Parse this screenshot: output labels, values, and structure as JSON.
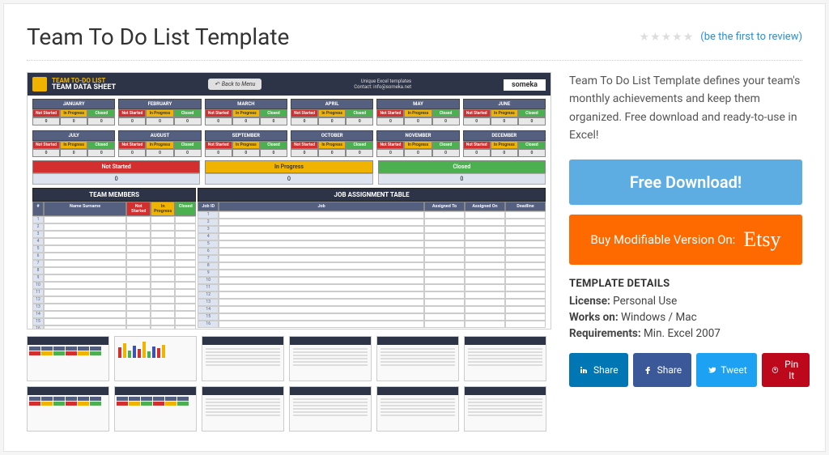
{
  "title": "Team To Do List Template",
  "review_link": "(be the first to review)",
  "description": "Team To Do List Template defines your team's monthly achievements and keep them organized. Free download and ready-to-use in Excel!",
  "buttons": {
    "download": "Free Download!",
    "etsy_prefix": "Buy Modifiable Version On:",
    "etsy_logo": "Etsy"
  },
  "details": {
    "heading": "TEMPLATE DETAILS",
    "license_label": "License:",
    "license_value": "Personal Use",
    "works_label": "Works on:",
    "works_value": "Windows / Mac",
    "req_label": "Requirements:",
    "req_value": "Min. Excel 2007"
  },
  "social": {
    "linkedin": "Share",
    "facebook": "Share",
    "twitter": "Tweet",
    "pinterest": "Pin It"
  },
  "preview": {
    "top_title1": "TEAM TO-DO LIST",
    "top_title2": "TEAM DATA SHEET",
    "back_btn": "Back to Menu",
    "unique": "Unique Excel templates",
    "contact": "Contact: info@someka.net",
    "logo": "someka",
    "months": [
      "JANUARY",
      "FEBRUARY",
      "MARCH",
      "APRIL",
      "MAY",
      "JUNE",
      "JULY",
      "AUGUST",
      "SEPTEMBER",
      "OCTOBER",
      "NOVEMBER",
      "DECEMBER"
    ],
    "status_labels": [
      "Not Started",
      "In Progress",
      "Closed"
    ],
    "status_values": [
      "0",
      "0",
      "0"
    ],
    "summary_value": "0",
    "table1_title": "TEAM MEMBERS",
    "table1_cols": [
      "#",
      "Name Surname",
      "Not Started",
      "In Progress",
      "Closed"
    ],
    "table2_title": "JOB ASSIGNMENT TABLE",
    "table2_cols": [
      "Job ID",
      "Job",
      "Assigned To",
      "Assigned On",
      "Deadline"
    ],
    "row_count": 16
  }
}
